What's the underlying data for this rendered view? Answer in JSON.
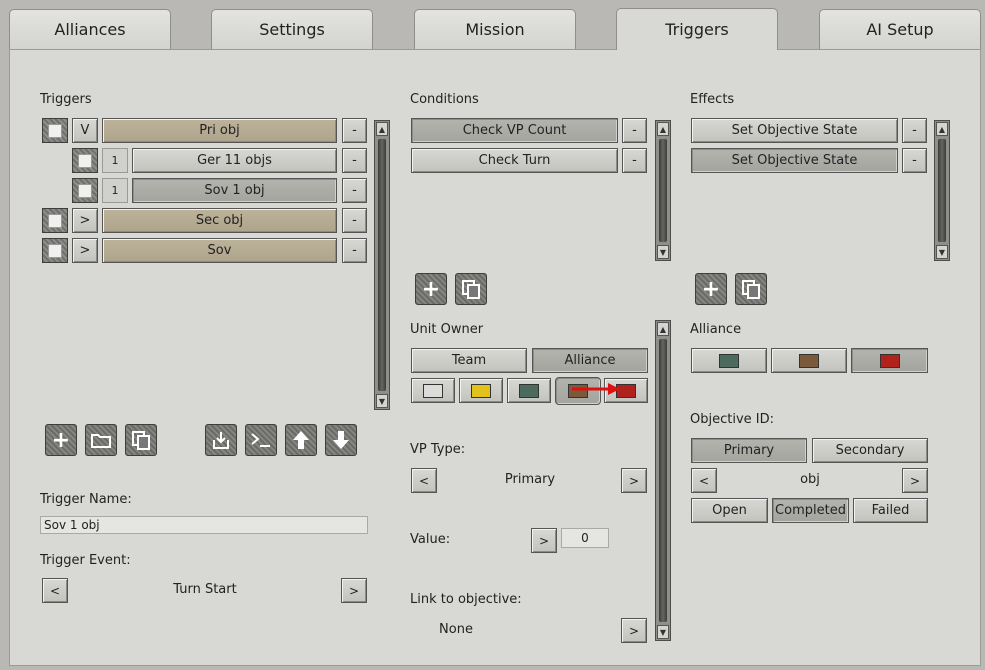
{
  "tabs": [
    "Alliances",
    "Settings",
    "Mission",
    "Triggers",
    "AI Setup"
  ],
  "triggers": {
    "heading": "Triggers",
    "rows": [
      {
        "toggle": "V",
        "label": "Pri obj"
      },
      {
        "count": "1",
        "label": "Ger 11 objs"
      },
      {
        "count": "1",
        "label": "Sov 1 obj"
      },
      {
        "toggle": ">",
        "label": "Sec obj"
      },
      {
        "toggle": ">",
        "label": "Sov"
      }
    ],
    "remove_label": "-",
    "name_label": "Trigger Name:",
    "name_value": "Sov 1 obj",
    "event_label": "Trigger Event:",
    "event_value": "Turn Start",
    "prev": "<",
    "next": ">"
  },
  "conditions": {
    "heading": "Conditions",
    "items": [
      "Check VP Count",
      "Check Turn"
    ],
    "remove_label": "-",
    "unit_owner_label": "Unit Owner",
    "owner_modes": [
      "Team",
      "Alliance"
    ],
    "owner_colors": [
      "#dcdcda",
      "#e1c21b",
      "#4d6a5e",
      "#7a5a3a",
      "#b1221c"
    ],
    "vp_type_label": "VP Type:",
    "vp_type_value": "Primary",
    "value_label": "Value:",
    "value_value": "0",
    "link_label": "Link to objective:",
    "link_value": "None",
    "prev": "<",
    "next": ">"
  },
  "effects": {
    "heading": "Effects",
    "items": [
      "Set Objective State",
      "Set Objective State"
    ],
    "remove_label": "-",
    "alliance_label": "Alliance",
    "alliance_colors": [
      "#4d6a5e",
      "#7a5a3a",
      "#b1221c"
    ],
    "objective_id_label": "Objective ID:",
    "objective_types": [
      "Primary",
      "Secondary"
    ],
    "objective_value": "obj",
    "states": [
      "Open",
      "Completed",
      "Failed"
    ],
    "prev": "<",
    "next": ">"
  }
}
